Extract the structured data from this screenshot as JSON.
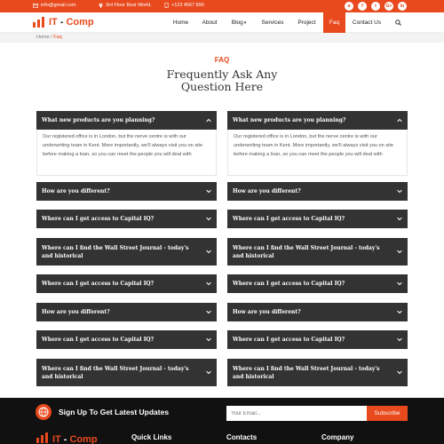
{
  "topbar": {
    "email": "info@gmail.com",
    "address": "3rd Floor Best World.",
    "phone": "+123 4567 890",
    "email_icon": "mail-icon",
    "address_icon": "map-pin-icon",
    "phone_icon": "phone-icon",
    "social": [
      {
        "icon": "rss-icon",
        "glyph": "ʀ"
      },
      {
        "icon": "facebook-icon",
        "glyph": "f"
      },
      {
        "icon": "twitter-icon",
        "glyph": "t"
      },
      {
        "icon": "google-plus-icon",
        "glyph": "G+"
      },
      {
        "icon": "linkedin-icon",
        "glyph": "in"
      }
    ]
  },
  "brand": {
    "it": "IT",
    "dash": "-",
    "comp": "Comp",
    "accent": "#e8491d"
  },
  "nav": {
    "home": "Home",
    "about": "About",
    "blog": "Blog",
    "blog_caret": "▾",
    "services": "Services",
    "project": "Project",
    "faq": "Faq",
    "contact": "Contact Us",
    "search_icon": "search-icon"
  },
  "breadcrumb": {
    "home": "Home",
    "sep": "/",
    "current": "Faq"
  },
  "faq": {
    "kicker": "FAQ",
    "title_line1": "Frequently Ask Any",
    "title_line2": "Question Here",
    "open_answer": "Our registered office is in London, but the nerve centre is with our underwriting team in Kent. More importantly, we'll always visit you on site before making a loan, so you can meet the people you will deal with",
    "left": [
      {
        "q": "What new products are you planning?",
        "open": true
      },
      {
        "q": "How are you different?",
        "open": false
      },
      {
        "q": "Where can I get access to Capital IQ?",
        "open": false
      },
      {
        "q": "Where can I find the Wall Street Journal - today's and historical",
        "open": false
      },
      {
        "q": "Where can I get access to Capital IQ?",
        "open": false
      },
      {
        "q": "How are you different?",
        "open": false
      },
      {
        "q": "Where can I get access to Capital IQ?",
        "open": false
      },
      {
        "q": "Where can I find the Wall Street Journal - today's and historical",
        "open": false
      }
    ],
    "right": [
      {
        "q": "What new products are you planning?",
        "open": true
      },
      {
        "q": "How are you different?",
        "open": false
      },
      {
        "q": "Where can I get access to Capital IQ?",
        "open": false
      },
      {
        "q": "Where can I find the Wall Street Journal - today's and historical",
        "open": false
      },
      {
        "q": "Where can I get access to Capital IQ?",
        "open": false
      },
      {
        "q": "How are you different?",
        "open": false
      },
      {
        "q": "Where can I get access to Capital IQ?",
        "open": false
      },
      {
        "q": "Where can I find the Wall Street Journal - today's and historical",
        "open": false
      }
    ]
  },
  "footer": {
    "subscribe_title": "Sign Up To Get Latest Updates",
    "email_placeholder": "Your Email...",
    "subscribe_button": "Subscribe",
    "quick_links": "Quick Links",
    "contacts": "Contacts",
    "company": "Company"
  }
}
